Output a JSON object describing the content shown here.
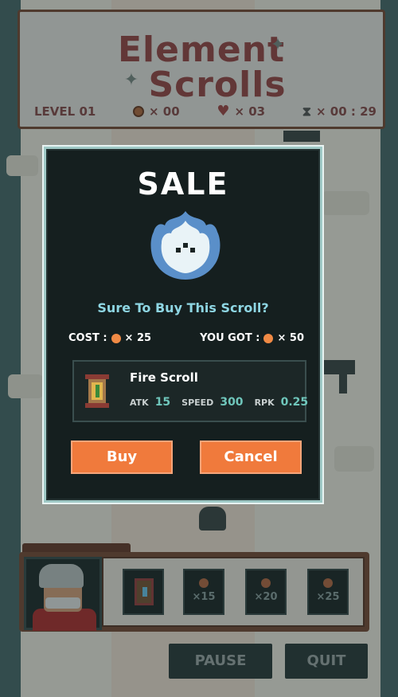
{
  "game": {
    "title_line1": "Element",
    "title_line2": "Scrolls",
    "hud": {
      "level": "LEVEL 01",
      "coins": "× 00",
      "lives": "× 03",
      "time": "× 00 : 29"
    },
    "slots": [
      {
        "label": "×15"
      },
      {
        "label": "×20"
      },
      {
        "label": "×25"
      }
    ],
    "controls": {
      "pause_label": "PAUSE",
      "quit_label": "QUIT"
    }
  },
  "dialog": {
    "title": "SALE",
    "question": "Sure To Buy This Scroll?",
    "cost_label": "COST :",
    "cost_value": "× 25",
    "got_label": "YOU GOT :",
    "got_value": "× 50",
    "scroll": {
      "name": "Fire Scroll",
      "atk_label": "ATK",
      "atk_value": "15",
      "speed_label": "SPEED",
      "speed_value": "300",
      "rpk_label": "RPK",
      "rpk_value": "0.25"
    },
    "buy_label": "Buy",
    "cancel_label": "Cancel"
  },
  "colors": {
    "accent_button": "#f07a3c",
    "dialog_bg": "#151f1f",
    "question_text": "#8ed6e3",
    "stat_value": "#6fc6bb",
    "coin": "#f08a45"
  },
  "icons": [
    "shuriken-icon",
    "coin-icon",
    "heart-icon",
    "hourglass-icon",
    "flame-icon",
    "scroll-icon"
  ]
}
